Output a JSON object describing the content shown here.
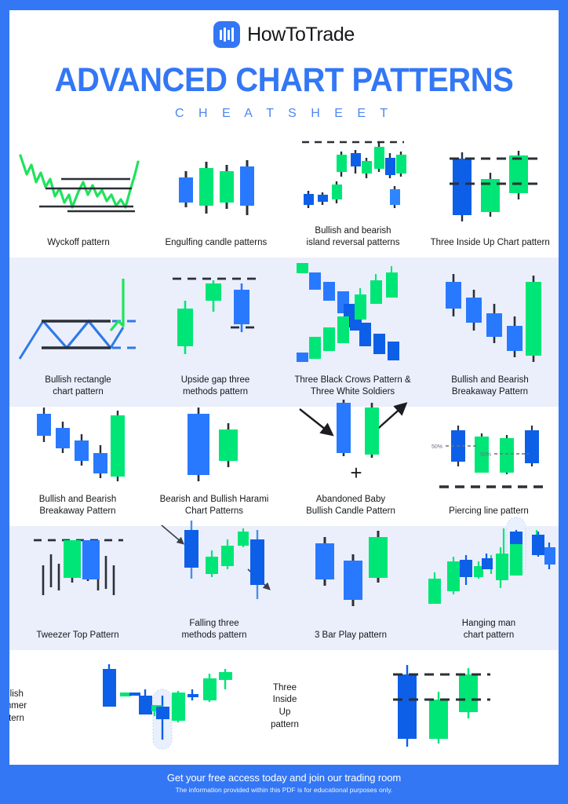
{
  "brand": {
    "name": "HowToTrade",
    "logo_icon": "bar-chart-logo-icon"
  },
  "header": {
    "title": "ADVANCED CHART PATTERNS",
    "subtitle": "C H E A T   S H E E T"
  },
  "colors": {
    "accent_blue": "#3377f5",
    "candle_blue": "#2979ff",
    "candle_blue_deep": "#0d5fe8",
    "candle_green": "#00e676",
    "line_green": "#1fe35c",
    "band_bg": "#ebeffc",
    "dark": "#15171a"
  },
  "rows": [
    {
      "tinted": false,
      "cells": [
        {
          "caption": "Wyckoff pattern",
          "art": "wyckoff"
        },
        {
          "caption": "Engulfing candle patterns",
          "art": "engulfing"
        },
        {
          "caption": "Bullish and bearish\nisland reversal patterns",
          "art": "island-reversal"
        },
        {
          "caption": "Three Inside Up Chart pattern",
          "art": "three-inside-up-chart"
        }
      ]
    },
    {
      "tinted": true,
      "cells": [
        {
          "caption": "Bullish rectangle\nchart pattern",
          "art": "bullish-rectangle"
        },
        {
          "caption": "Upside gap three\nmethods pattern",
          "art": "upside-gap-three"
        },
        {
          "caption": "Three Black Crows Pattern &\nThree White Soldiers",
          "art": "crows-soldiers"
        },
        {
          "caption": "Bullish and Bearish\nBreakaway Pattern",
          "art": "breakaway-a"
        }
      ]
    },
    {
      "tinted": false,
      "cells": [
        {
          "caption": "Bullish and Bearish\nBreakaway Pattern",
          "art": "breakaway-b"
        },
        {
          "caption": "Bearish and Bullish Harami\nChart Patterns",
          "art": "harami"
        },
        {
          "caption": "Abandoned Baby\nBullish Candle Pattern",
          "art": "abandoned-baby",
          "plus_label": "+"
        },
        {
          "caption": "Piercing line pattern",
          "art": "piercing-line",
          "level_labels": [
            "50%",
            "50%"
          ]
        }
      ]
    },
    {
      "tinted": true,
      "cells": [
        {
          "caption": "Tweezer Top Pattern",
          "art": "tweezer-top"
        },
        {
          "caption": "Falling three\nmethods pattern",
          "art": "falling-three"
        },
        {
          "caption": "3 Bar Play pattern",
          "art": "three-bar-play"
        },
        {
          "caption": "Hanging man\nchart pattern",
          "art": "hanging-man"
        }
      ]
    },
    {
      "tinted": false,
      "cells": [
        {
          "caption": "Bullish\nhammer\npattern",
          "art": "bullish-hammer",
          "label_side": "left"
        },
        {
          "caption": "Three Inside\nUp pattern",
          "art": "three-inside-up",
          "label_side": "left"
        }
      ]
    }
  ],
  "footer": {
    "line1": "Get your free access today and join our trading room",
    "line2": "The information provided within this PDF is for educational purposes only."
  }
}
